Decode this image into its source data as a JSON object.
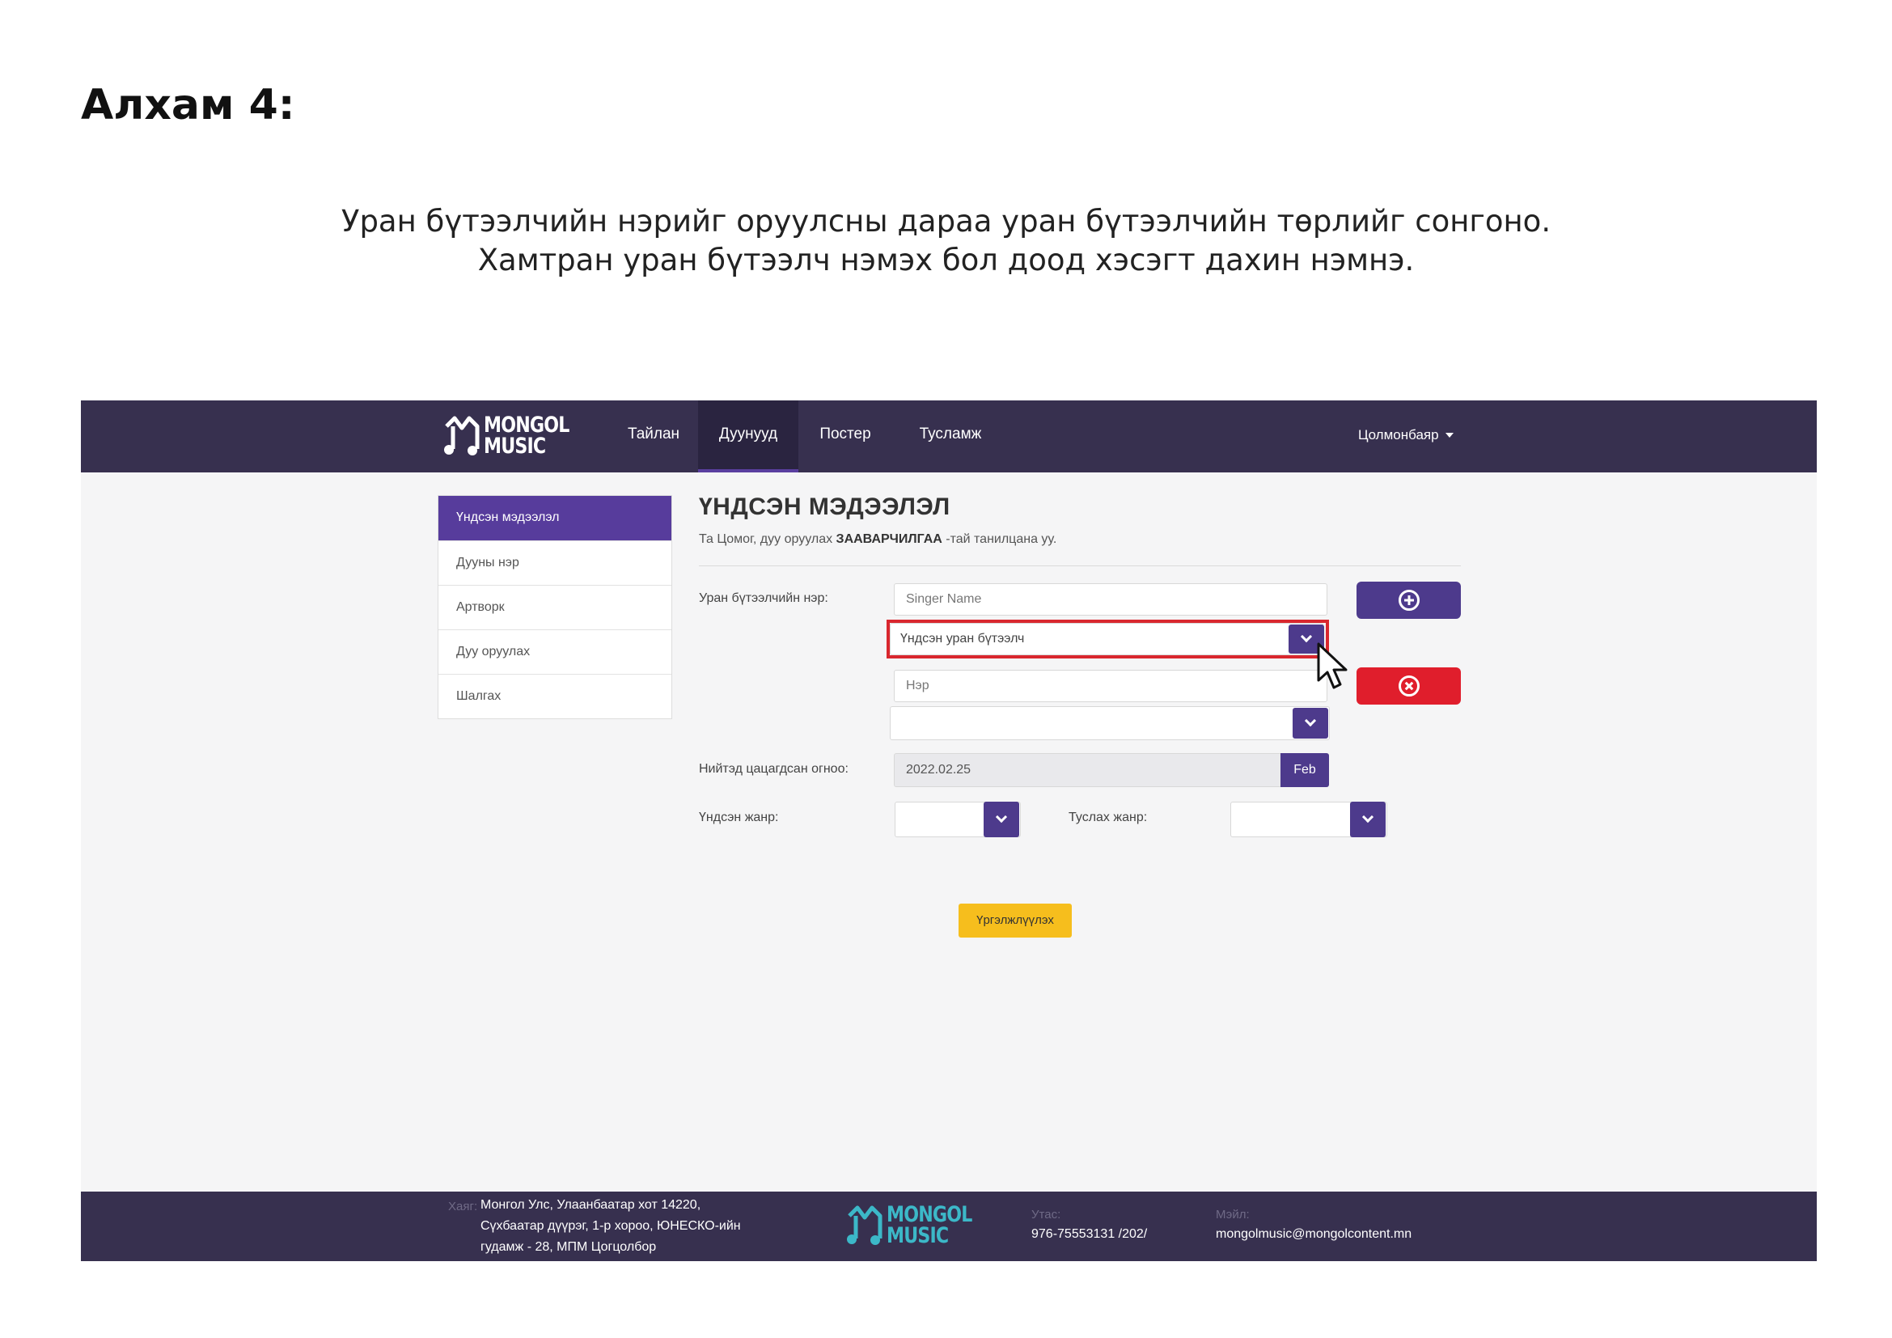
{
  "step_title": "Алхам 4:",
  "instructions": {
    "line1": "Уран бүтээлчийн нэрийг оруулсны дараа уран бүтээлчийн төрлийг сонгоно.",
    "line2": "Хамтран уран бүтээлч нэмэх бол доод хэсэгт дахин нэмнэ."
  },
  "colors": {
    "navbar": "#37304f",
    "accent": "#573c9c",
    "button_primary": "#4d3a8c",
    "button_danger": "#e01e2c",
    "button_continue": "#f6be1d",
    "highlight": "#d9272e",
    "logo_teal": "#3cb8c8"
  },
  "brand": {
    "line1": "MONGOL",
    "line2": "MUSIC"
  },
  "nav": {
    "items": [
      "Тайлан",
      "Дуунууд",
      "Постер",
      "Тусламж"
    ],
    "active": "Дуунууд",
    "user": "Цолмонбаяр"
  },
  "sidebar": {
    "items": [
      "Үндсэн мэдээлэл",
      "Дууны нэр",
      "Артворк",
      "Дуу оруулах",
      "Шалгах"
    ],
    "active": "Үндсэн мэдээлэл"
  },
  "main": {
    "title": "ҮНДСЭН МЭДЭЭЛЭЛ",
    "subtitle_before": "Та Цомог, дуу оруулах",
    "subtitle_bold": "ЗААВАРЧИЛГАА",
    "subtitle_after": "-тай танилцана уу.",
    "artist_label": "Уран бүтээлчийн нэр:",
    "artist1_placeholder": "Singer Name",
    "artist1_type": "Үндсэн уран бүтээлч",
    "artist2_placeholder": "Нэр",
    "artist2_type": "",
    "release_label": "Нийтэд цацагдсан огноо:",
    "release_date": "2022.02.25",
    "release_button": "Feb",
    "main_genre_label": "Үндсэн жанр:",
    "main_genre_value": "",
    "sub_genre_label": "Туслах жанр:",
    "sub_genre_value": "",
    "continue_label": "Үргэлжлүүлэх"
  },
  "icons": {
    "add": "plus-circle-icon",
    "remove": "times-circle-icon",
    "dropdown": "chevron-down-icon",
    "cursor": "mouse-pointer-icon"
  },
  "footer": {
    "address_label": "Хаяг:",
    "address": [
      "Монгол Улс, Улаанбаатар хот 14220,",
      "Сүхбаатар дүүрэг, 1-р хороо, ЮНЕСКО-ийн",
      "гудамж - 28, МПМ Цогцолбор"
    ],
    "phone_label": "Утас:",
    "phone": "976-75553131 /202/",
    "email_label": "Мэйл:",
    "email": "mongolmusic@mongolcontent.mn"
  }
}
